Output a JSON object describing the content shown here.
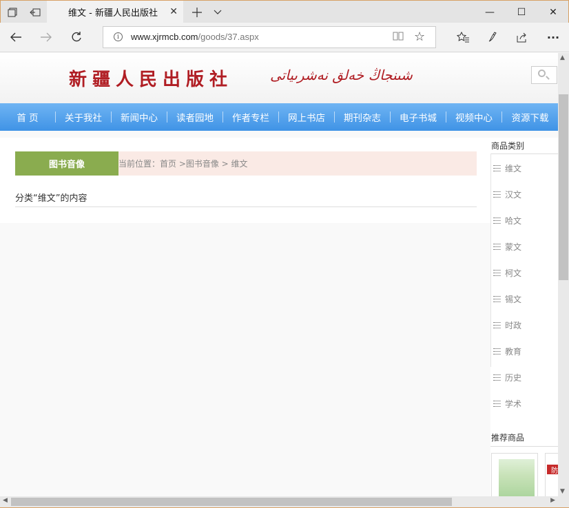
{
  "browser": {
    "tab": {
      "title": "维文 - 新疆人民出版社",
      "close_glyph": "✕"
    },
    "tabstrip_icons": [
      "tab-list-icon",
      "set-aside-tabs-icon",
      "new-tab-icon",
      "chevron-down-icon"
    ],
    "window_controls": {
      "minimize": "—",
      "maximize": "☐",
      "close": "✕"
    },
    "address": {
      "host": "www.xjrmcb.com",
      "path": "/goods/37.aspx",
      "info_glyph": "i"
    },
    "toolbar_glyphs": {
      "back": "←",
      "forward": "→",
      "refresh": "↻",
      "reading": "📖",
      "favorite": "☆",
      "favorites_list": "☆≡",
      "notes": "✎",
      "share": "⇪",
      "more": "···"
    }
  },
  "site": {
    "logo_cn": "新疆人民出版社",
    "logo_ug": "شىنجاڭ خەلق نەشرىياتى",
    "nav": [
      "首 页",
      "关于我社",
      "新闻中心",
      "读者园地",
      "作者专栏",
      "网上书店",
      "期刊杂志",
      "电子书城",
      "视频中心",
      "资源下载"
    ]
  },
  "breadcrumb": {
    "section": "图书音像",
    "text": "当前位置：首页 >图书音像  > 维文"
  },
  "category_title": "分类“维文”的内容",
  "sidebar": {
    "heading": "商品类别",
    "items": [
      "维文",
      "汉文",
      "哈文",
      "蒙文",
      "柯文",
      "锡文",
      "时政",
      "教育",
      "历史",
      "学术"
    ],
    "recommend_heading": "推荐商品",
    "thumb2_text": "防"
  },
  "colors": {
    "nav_blue": "#4a9ae9",
    "crumb_green": "#8aac4f",
    "crumb_bg": "#faeae5",
    "logo_red": "#b01d23",
    "window_border": "#d7a064"
  }
}
